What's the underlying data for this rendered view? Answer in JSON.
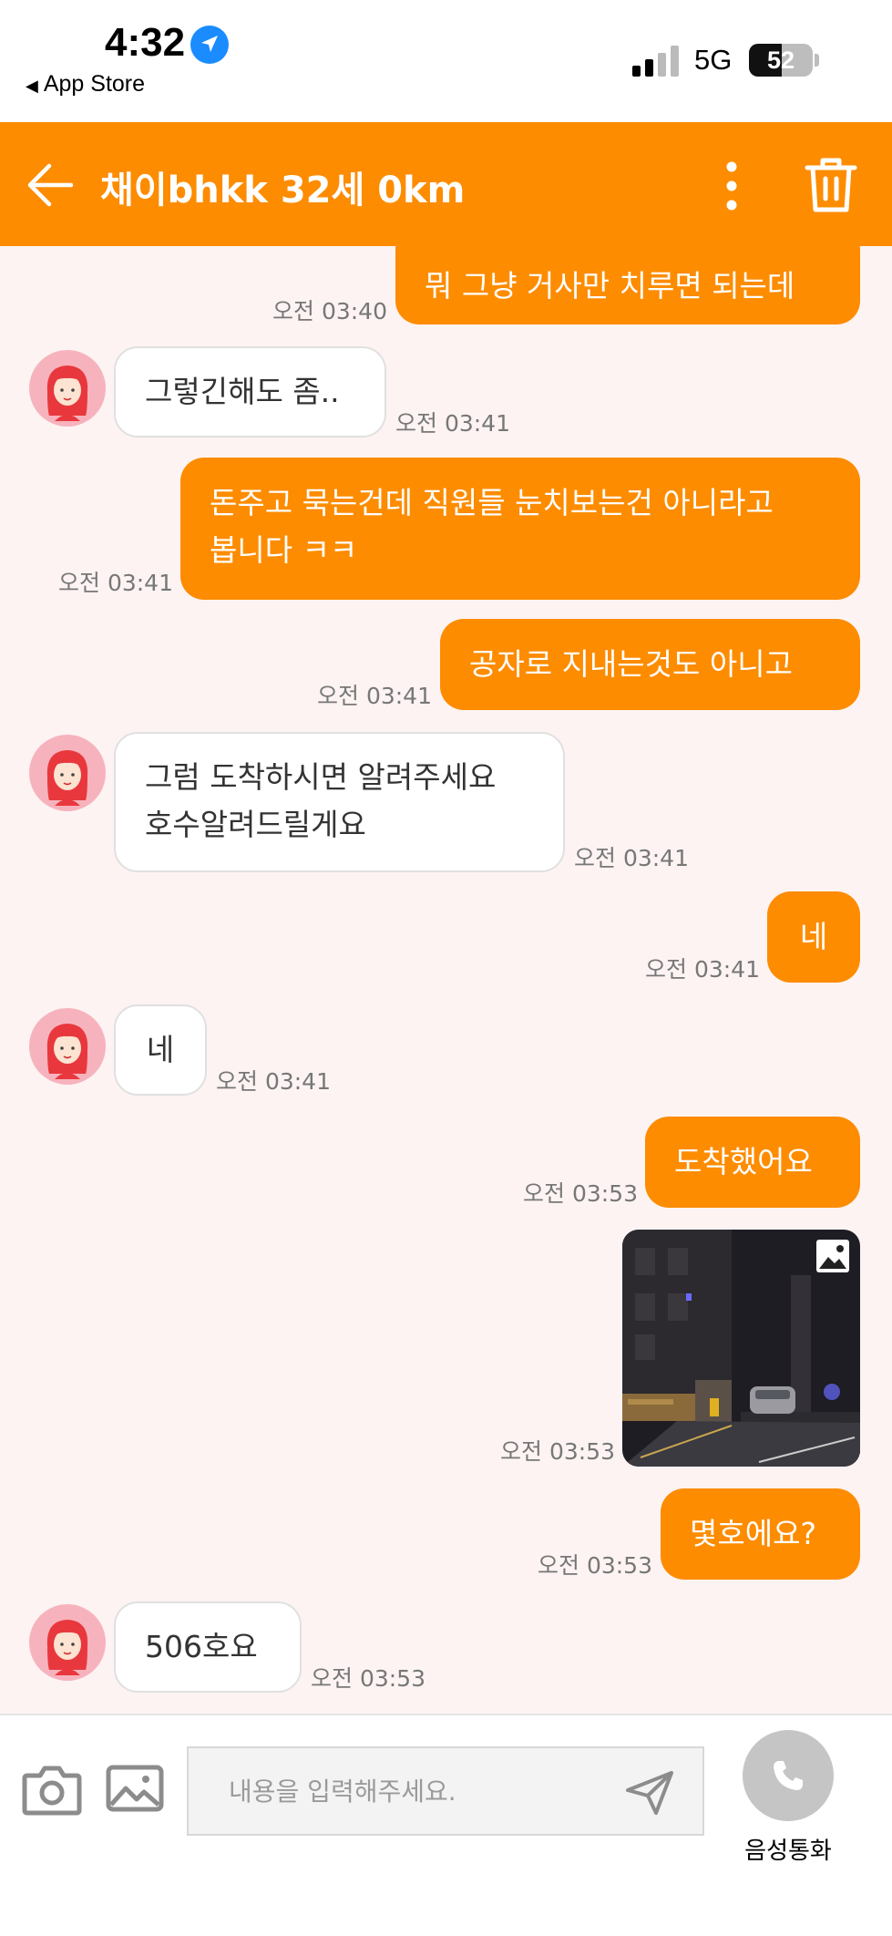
{
  "status_bar": {
    "time": "4:32",
    "back_app": "App Store",
    "network": "5G",
    "battery_level": "52",
    "icons": [
      "location-arrow-icon",
      "signal-bars-icon",
      "battery-icon"
    ]
  },
  "header": {
    "title": "채이bhkk 32세 0km",
    "background_color": "#fd8c00",
    "icons": [
      "back-arrow-icon",
      "more-vertical-icon",
      "trash-icon"
    ]
  },
  "messages": [
    {
      "sender": "me",
      "text": "뭐 그냥 거사만 치루면 되는데",
      "time": "오전 03:40"
    },
    {
      "sender": "other",
      "text": "그렇긴해도 좀..",
      "time": "오전 03:41"
    },
    {
      "sender": "me",
      "lines": [
        "돈주고 묵는건데 직원들 눈치보는건 아니라고",
        "봅니다 ㅋㅋ"
      ],
      "time": "오전 03:41"
    },
    {
      "sender": "me",
      "text": "공자로 지내는것도 아니고",
      "time": "오전 03:41"
    },
    {
      "sender": "other",
      "lines": [
        "그럼 도착하시면 알려주세요",
        "호수알려드릴게요"
      ],
      "time": "오전 03:41"
    },
    {
      "sender": "me",
      "text": "네",
      "time": "오전 03:41"
    },
    {
      "sender": "other",
      "text": "네",
      "time": "오전 03:41"
    },
    {
      "sender": "me",
      "text": "도착했어요",
      "time": "오전 03:53"
    },
    {
      "sender": "me",
      "type": "image",
      "icon": "image-icon",
      "time": "오전 03:53"
    },
    {
      "sender": "me",
      "text": "몇호에요?",
      "time": "오전 03:53"
    },
    {
      "sender": "other",
      "text": "506호요",
      "time": "오전 03:53"
    }
  ],
  "input_bar": {
    "placeholder": "내용을 입력해주세요.",
    "value": "",
    "call_label": "음성통화",
    "icons": [
      "camera-icon",
      "gallery-icon",
      "send-icon",
      "phone-icon"
    ]
  }
}
